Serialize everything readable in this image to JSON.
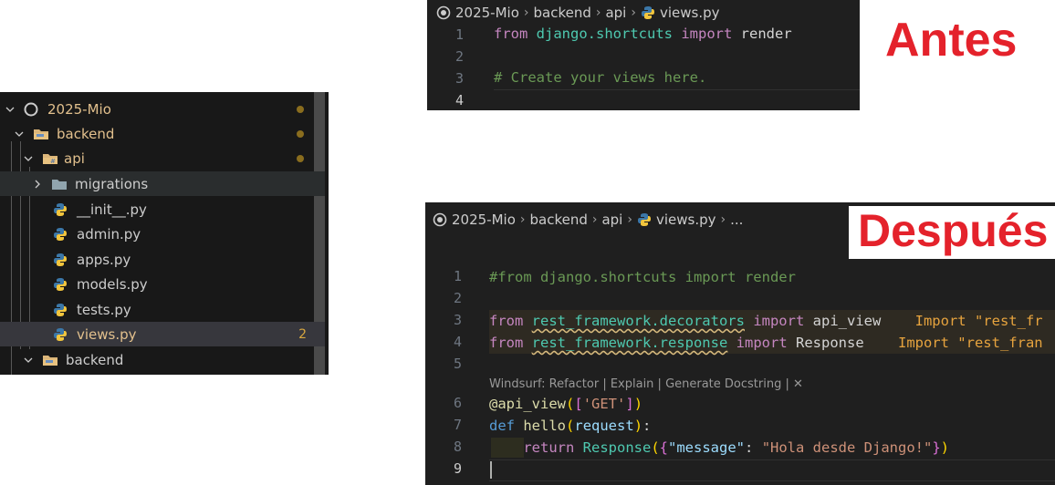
{
  "explorer": {
    "items": [
      {
        "label": "2025-Mio",
        "icon": "circle-outline-icon"
      },
      {
        "label": "backend",
        "icon": "folder-open-icon"
      },
      {
        "label": "api",
        "icon": "folder-open-icon"
      },
      {
        "label": "migrations",
        "icon": "folder-icon"
      },
      {
        "label": "__init__.py",
        "icon": "python-icon"
      },
      {
        "label": "admin.py",
        "icon": "python-icon"
      },
      {
        "label": "apps.py",
        "icon": "python-icon"
      },
      {
        "label": "models.py",
        "icon": "python-icon"
      },
      {
        "label": "tests.py",
        "icon": "python-icon"
      },
      {
        "label": "views.py",
        "icon": "python-icon",
        "badge": "2"
      },
      {
        "label": "backend",
        "icon": "folder-open-icon"
      }
    ]
  },
  "before": {
    "breadcrumb": [
      "2025-Mio",
      "backend",
      "api",
      "views.py"
    ],
    "line_numbers": [
      "1",
      "2",
      "3",
      "4"
    ],
    "code": {
      "l1": {
        "kw1": "from",
        "mod": "django.shortcuts",
        "kw2": "import",
        "name": "render"
      },
      "l3": "# Create your views here."
    },
    "label": "Antes"
  },
  "after": {
    "breadcrumb": [
      "2025-Mio",
      "backend",
      "api",
      "views.py",
      "..."
    ],
    "line_numbers": [
      "1",
      "2",
      "3",
      "4",
      "5",
      "6",
      "7",
      "8",
      "9"
    ],
    "code": {
      "l1": "#from django.shortcuts import render",
      "l3": {
        "kw1": "from",
        "mod": "rest_framework.decorators",
        "kw2": "import",
        "name": "api_view",
        "hint": "Import \"rest_fr"
      },
      "l4": {
        "kw1": "from",
        "mod": "rest_framework.response",
        "kw2": "import",
        "name": "Response",
        "hint": "Import \"rest_fran"
      },
      "codelens": "Windsurf: Refactor | Explain | Generate Docstring | ✕",
      "l6": {
        "at": "@api_view",
        "b1": "(",
        "b2": "[",
        "str": "'GET'",
        "b3": "]",
        "b4": ")"
      },
      "l7": {
        "kw": "def",
        "fn": "hello",
        "b1": "(",
        "param": "request",
        "b2": ")",
        "colon": ":"
      },
      "l8": {
        "kw": "return",
        "cls": "Response",
        "b1": "(",
        "b2": "{",
        "key": "\"message\"",
        "colon": ": ",
        "val": "\"Hola desde Django!\"",
        "b3": "}",
        "b4": ")"
      }
    },
    "label": "Después"
  },
  "colors": {
    "label_red": "#e4222b",
    "editor_bg": "#1f1f1f",
    "explorer_bg": "#181818"
  }
}
